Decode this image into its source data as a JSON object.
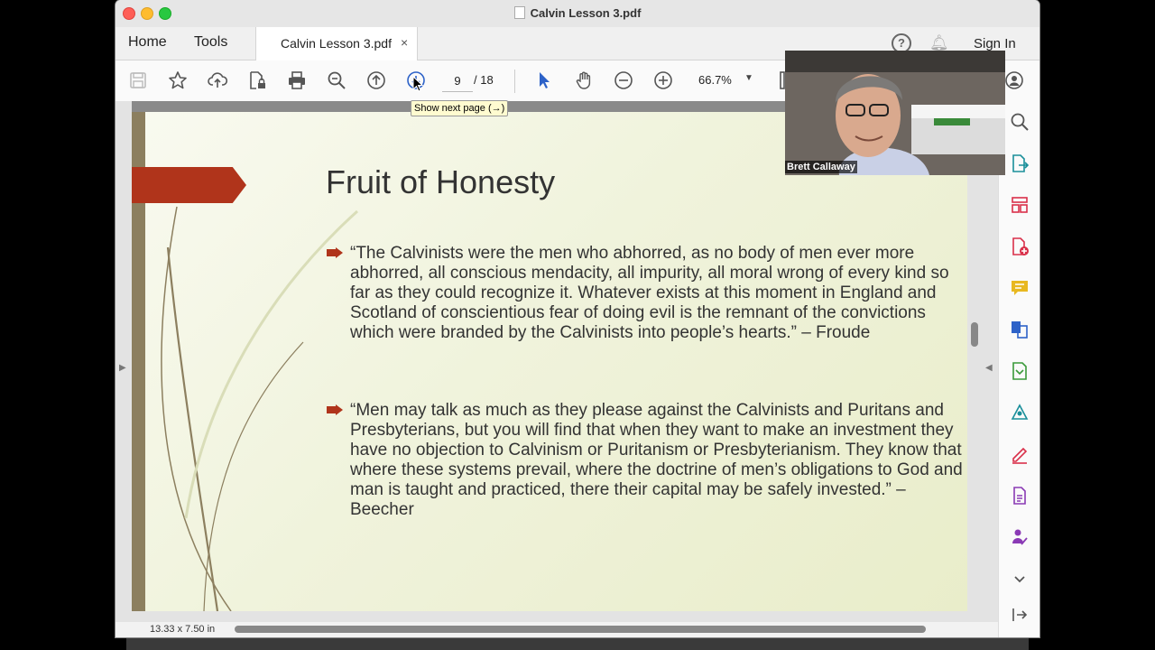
{
  "window": {
    "title": "Calvin Lesson 3.pdf"
  },
  "tabs": {
    "home": "Home",
    "tools": "Tools",
    "document": "Calvin Lesson 3.pdf",
    "close": "×",
    "sign_in": "Sign In"
  },
  "toolbar": {
    "current_page": "9",
    "page_total": "/  18",
    "zoom": "66.7%",
    "tooltip": "Show next page (→)"
  },
  "slide": {
    "title": "Fruit of Honesty",
    "quote1": "“The Calvinists were the men who abhorred, as no body of men ever more abhorred, all conscious mendacity, all impurity, all moral wrong of every kind so far as they could recognize it. Whatever exists at this moment in England and Scotland of conscientious fear of doing evil is the remnant of the convictions which were branded by the Calvinists into people’s hearts.” – Froude",
    "quote2": "“Men may talk as much as they please against the Calvinists and Puritans and Presbyterians, but you will find that when they want to make an investment they have no objection to Calvinism or Puritanism or Presbyterianism. They know that where these systems prevail, where the doctrine of men’s obligations to God and man is taught and practiced, there their capital may be safely invested.” – Beecher"
  },
  "status": {
    "page_size": "13.33 x 7.50 in"
  },
  "video": {
    "participant": "Brett Callaway"
  },
  "colors": {
    "accent": "#2d62c8",
    "banner": "#b0341b",
    "tool_red": "#d9304a",
    "tool_teal": "#1a8f9a",
    "tool_purple": "#8a3ab5"
  }
}
